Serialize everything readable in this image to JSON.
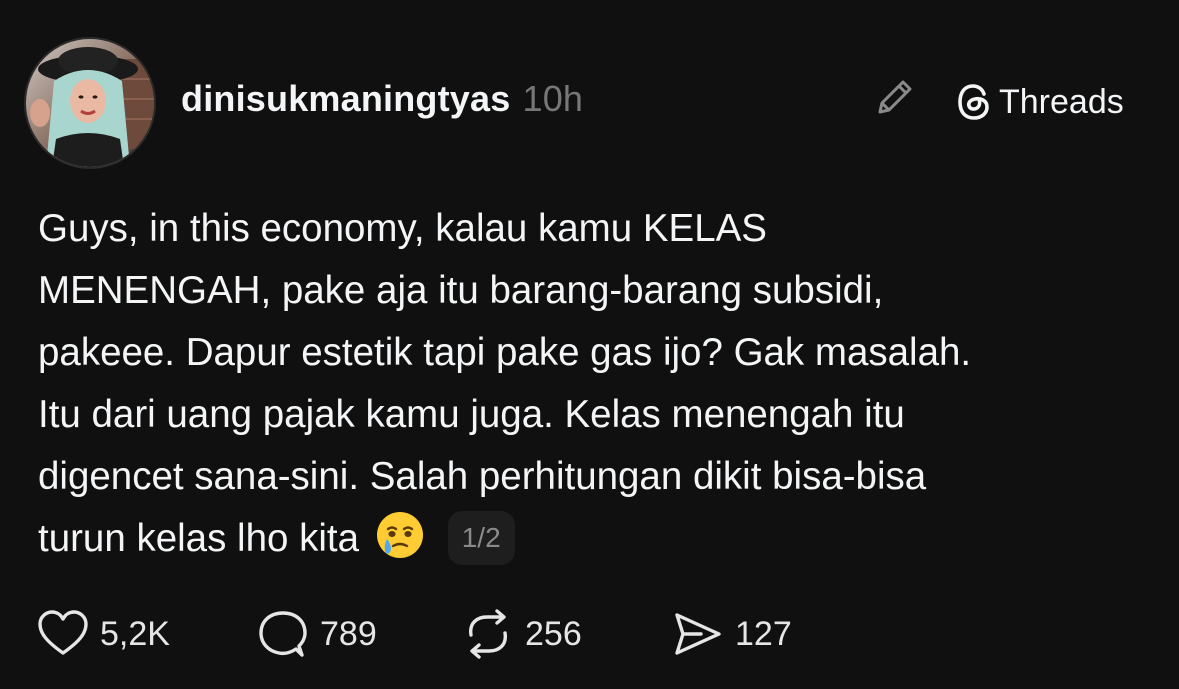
{
  "post": {
    "username": "dinisukmaningtyas",
    "timestamp": "10h",
    "brand": "Threads",
    "text_lines": [
      "Guys, in this economy, kalau kamu KELAS",
      "MENENGAH, pake aja itu barang-barang subsidi,",
      "pakeee. Dapur estetik tapi pake gas ijo? Gak masalah.",
      "Itu dari uang pajak kamu juga. Kelas menengah itu",
      "digencet sana-sini. Salah perhitungan dikit bisa-bisa",
      "turun kelas lho kita"
    ],
    "emoji": "face-holding-back-tears",
    "page_indicator": "1/2"
  },
  "actions": {
    "likes": "5,2K",
    "replies": "789",
    "reposts": "256",
    "shares": "127"
  },
  "colors": {
    "background": "#101010",
    "text": "#f3f5f7",
    "muted": "#777777",
    "badge_bg": "#1e1e1e"
  },
  "icons": [
    "pencil-icon",
    "threads-logo-icon",
    "heart-icon",
    "comment-icon",
    "repost-icon",
    "share-icon"
  ]
}
